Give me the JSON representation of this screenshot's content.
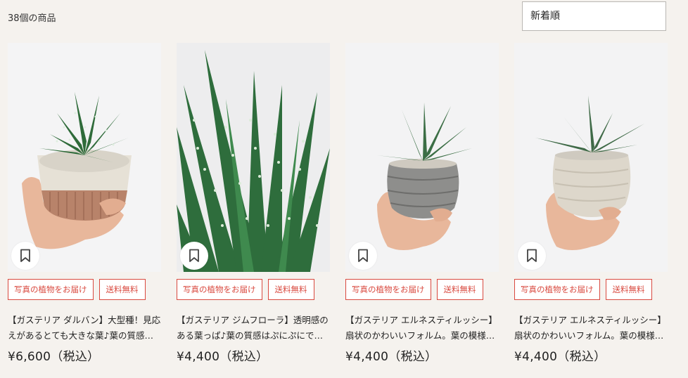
{
  "header": {
    "result_count": "38個の商品",
    "sort_value": "新着順"
  },
  "products": [
    {
      "tag_photo": "写真の植物をお届け",
      "tag_shipping": "送料無料",
      "title": "【ガステリア ダルバン】大型種！見応えがあるとても大きな葉♪葉の質感が美しい",
      "price": "¥6,600（税込）"
    },
    {
      "tag_photo": "写真の植物をお届け",
      "tag_shipping": "送料無料",
      "title": "【ガステリア ジムフローラ】透明感のある葉っぱ♪葉の質感はぷにぷにで可愛い",
      "price": "¥4,400（税込）"
    },
    {
      "tag_photo": "写真の植物をお届け",
      "tag_shipping": "送料無料",
      "title": "【ガステリア エルネスティルッシー】扇状のかわいいフォルム。葉の模様が美しい",
      "price": "¥4,400（税込）"
    },
    {
      "tag_photo": "写真の植物をお届け",
      "tag_shipping": "送料無料",
      "title": "【ガステリア エルネスティルッシー】扇状のかわいいフォルム。葉の模様が美しい",
      "price": "¥4,400（税込）"
    }
  ],
  "icons": {
    "bookmark": "bookmark-icon",
    "product_image": "plant-photo"
  },
  "colors": {
    "background": "#f5f2ee",
    "tag_accent": "#d9493f",
    "leaf": "#2f6b3a"
  }
}
